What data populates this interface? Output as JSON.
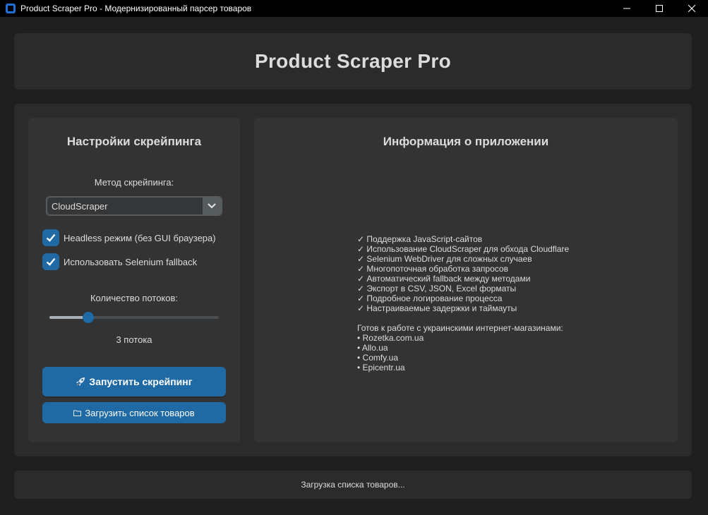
{
  "window": {
    "title": "Product Scraper Pro - Модернизированный парсер товаров",
    "icon": "app-icon"
  },
  "header": {
    "title": "Product Scraper Pro"
  },
  "settings": {
    "title": "Настройки скрейпинга",
    "method_label": "Метод скрейпинга:",
    "method_value": "CloudScraper",
    "headless_label": "Headless режим (без GUI браузера)",
    "headless_checked": true,
    "selenium_label": "Использовать Selenium fallback",
    "selenium_checked": true,
    "threads_label": "Количество потоков:",
    "threads_fraction": 0.23,
    "threads_value_text": "3 потока",
    "start_button": "Запустить скрейпинг",
    "start_icon": "rocket-icon",
    "load_button": "Загрузить список товаров",
    "load_icon": "folder-icon"
  },
  "info": {
    "title": "Информация о приложении",
    "features": [
      "✓ Поддержка JavaScript-сайтов",
      "✓ Использование CloudScraper для обхода Cloudflare",
      "✓ Selenium WebDriver для сложных случаев",
      "✓ Многопоточная обработка запросов",
      "✓ Автоматический fallback между методами",
      "✓ Экспорт в CSV, JSON, Excel форматы",
      "✓ Подробное логирование процесса",
      "✓ Настраиваемые задержки и таймауты"
    ],
    "stores_heading": "Готов к работе с украинскими интернет-магазинами:",
    "stores": [
      "• Rozetka.com.ua",
      "• Allo.ua",
      "• Comfy.ua",
      "• Epicentr.ua"
    ]
  },
  "status": {
    "text": "Загрузка списка товаров..."
  },
  "colors": {
    "accent": "#1f6aa5",
    "background": "#1f1f1f",
    "panel": "#2b2b2b",
    "frame": "#333333"
  }
}
